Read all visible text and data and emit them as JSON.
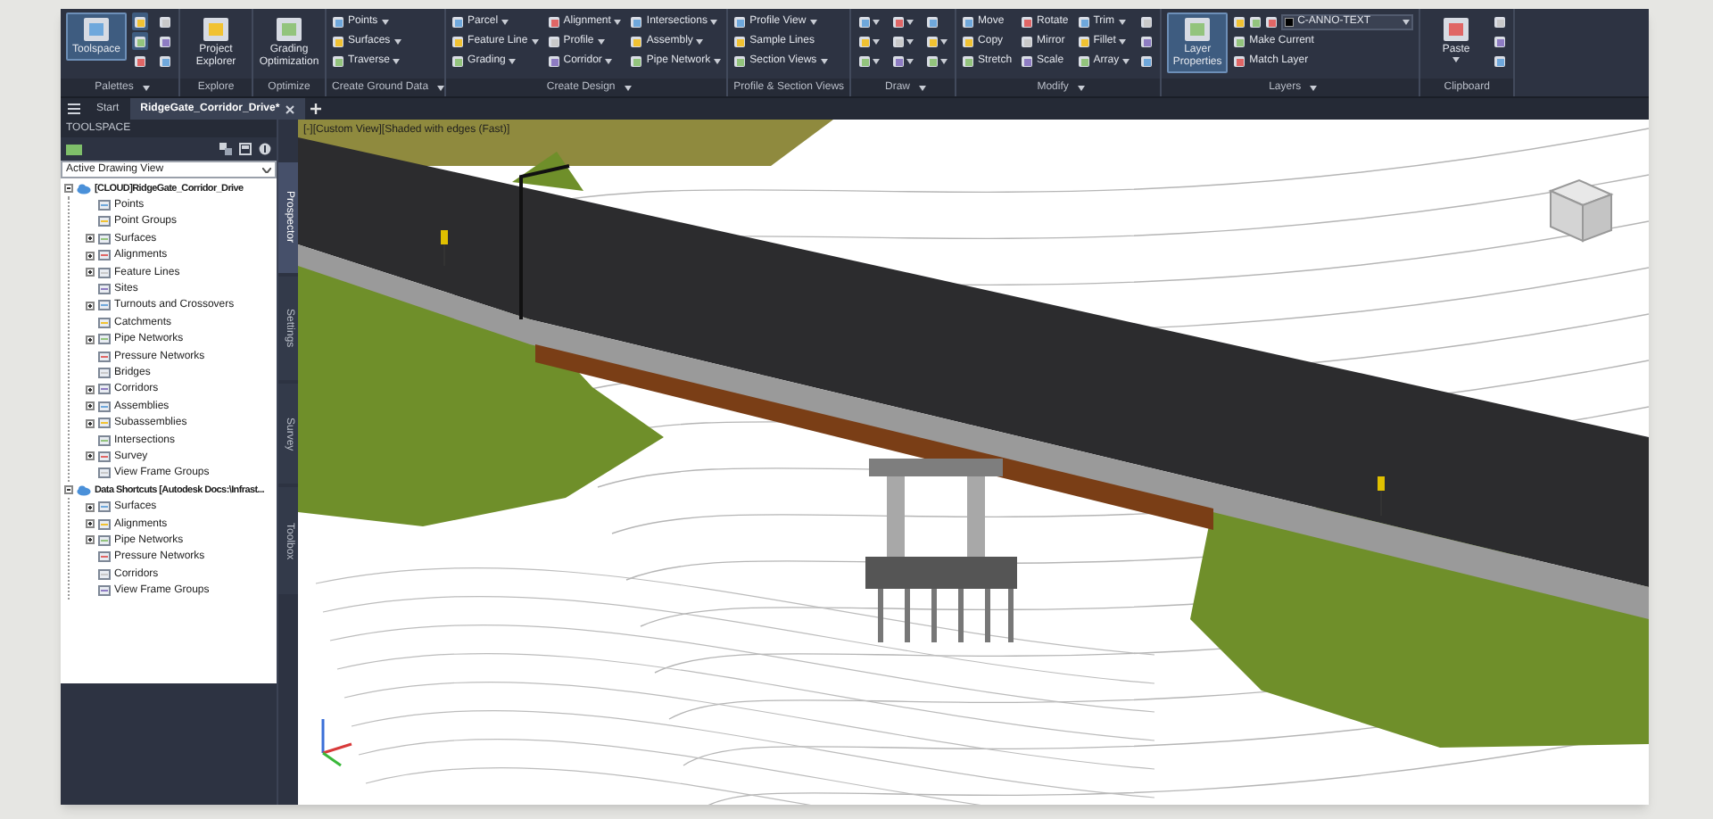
{
  "ribbon": {
    "panels": [
      {
        "title": "Palettes",
        "dropdown": true,
        "items": [
          {
            "kind": "large",
            "label": "Toolspace",
            "on": true
          },
          {
            "kind": "icon",
            "on": true
          },
          {
            "kind": "icon",
            "on": true
          },
          {
            "kind": "icon",
            "on": false
          },
          {
            "kind": "icon",
            "on": false
          },
          {
            "kind": "icon",
            "on": false
          },
          {
            "kind": "icon",
            "on": false
          }
        ]
      },
      {
        "title": "Explore",
        "dropdown": false,
        "items": [
          {
            "kind": "large",
            "label": "Project Explorer"
          }
        ]
      },
      {
        "title": "Optimize",
        "dropdown": false,
        "items": [
          {
            "kind": "large",
            "label": "Grading Optimization"
          }
        ]
      },
      {
        "title": "Create Ground Data",
        "dropdown": true,
        "items": [
          {
            "kind": "small",
            "label": "Points",
            "dropdown": true
          },
          {
            "kind": "small",
            "label": "Surfaces",
            "dropdown": true
          },
          {
            "kind": "small",
            "label": "Traverse",
            "dropdown": true
          }
        ]
      },
      {
        "title": "Create Design",
        "dropdown": true,
        "items": [
          {
            "kind": "small",
            "label": "Parcel",
            "dropdown": true
          },
          {
            "kind": "small",
            "label": "Feature Line",
            "dropdown": true
          },
          {
            "kind": "small",
            "label": "Grading",
            "dropdown": true
          },
          {
            "kind": "small",
            "label": "Alignment",
            "dropdown": true
          },
          {
            "kind": "small",
            "label": "Profile",
            "dropdown": true
          },
          {
            "kind": "small",
            "label": "Corridor",
            "dropdown": true
          },
          {
            "kind": "small",
            "label": "Intersections",
            "dropdown": true
          },
          {
            "kind": "small",
            "label": "Assembly",
            "dropdown": true
          },
          {
            "kind": "small",
            "label": "Pipe Network",
            "dropdown": true
          }
        ]
      },
      {
        "title": "Profile & Section Views",
        "dropdown": false,
        "items": [
          {
            "kind": "small",
            "label": "Profile View",
            "dropdown": true
          },
          {
            "kind": "small",
            "label": "Sample Lines",
            "dropdown": false
          },
          {
            "kind": "small",
            "label": "Section Views",
            "dropdown": true
          }
        ]
      },
      {
        "title": "Draw",
        "dropdown": true,
        "items": [
          {
            "kind": "icon",
            "dropdown": true
          },
          {
            "kind": "icon",
            "dropdown": true
          },
          {
            "kind": "icon",
            "dropdown": true
          },
          {
            "kind": "icon",
            "dropdown": true
          },
          {
            "kind": "icon",
            "dropdown": true
          },
          {
            "kind": "icon",
            "dropdown": true
          },
          {
            "kind": "icon",
            "dropdown": false
          },
          {
            "kind": "icon",
            "dropdown": true
          },
          {
            "kind": "icon",
            "dropdown": true
          }
        ]
      },
      {
        "title": "Modify",
        "dropdown": true,
        "items": [
          {
            "kind": "small",
            "label": "Move",
            "dropdown": false
          },
          {
            "kind": "small",
            "label": "Copy",
            "dropdown": false
          },
          {
            "kind": "small",
            "label": "Stretch",
            "dropdown": false
          },
          {
            "kind": "small",
            "label": "Rotate",
            "dropdown": false
          },
          {
            "kind": "small",
            "label": "Mirror",
            "dropdown": false
          },
          {
            "kind": "small",
            "label": "Scale",
            "dropdown": false
          },
          {
            "kind": "small",
            "label": "Trim",
            "dropdown": true
          },
          {
            "kind": "small",
            "label": "Fillet",
            "dropdown": true
          },
          {
            "kind": "small",
            "label": "Array",
            "dropdown": true
          },
          {
            "kind": "icon",
            "dropdown": false
          },
          {
            "kind": "icon",
            "dropdown": false
          },
          {
            "kind": "icon",
            "dropdown": false
          }
        ]
      },
      {
        "title": "Layers",
        "dropdown": true,
        "items": [
          {
            "kind": "large",
            "label": "Layer Properties",
            "on": true
          },
          {
            "kind": "combo",
            "value": "C-ANNO-TEXT"
          },
          {
            "kind": "small",
            "label": "Make Current",
            "dropdown": false
          },
          {
            "kind": "small",
            "label": "Match Layer",
            "dropdown": false
          }
        ]
      },
      {
        "title": "Clipboard",
        "dropdown": false,
        "items": [
          {
            "kind": "large",
            "label": "Paste",
            "dropdown": true
          },
          {
            "kind": "icon",
            "dropdown": false
          },
          {
            "kind": "icon",
            "dropdown": false
          },
          {
            "kind": "icon",
            "dropdown": false
          }
        ]
      }
    ]
  },
  "tabs": [
    {
      "label": "Start",
      "selected": false
    },
    {
      "label": "RidgeGate_Corridor_Drive*",
      "selected": true
    }
  ],
  "toolspace": {
    "title": "TOOLSPACE",
    "view": "Active Drawing View",
    "tree": [
      {
        "label": "[CLOUD]RidgeGate_Corridor_Drive",
        "kind": "expanded",
        "children": [
          {
            "label": "Points",
            "kind": "leaf"
          },
          {
            "label": "Point Groups",
            "kind": "leaf"
          },
          {
            "label": "Surfaces",
            "kind": "collapsed"
          },
          {
            "label": "Alignments",
            "kind": "collapsed"
          },
          {
            "label": "Feature Lines",
            "kind": "collapsed"
          },
          {
            "label": "Sites",
            "kind": "leaf"
          },
          {
            "label": "Turnouts and Crossovers",
            "kind": "collapsed"
          },
          {
            "label": "Catchments",
            "kind": "leaf"
          },
          {
            "label": "Pipe Networks",
            "kind": "collapsed"
          },
          {
            "label": "Pressure Networks",
            "kind": "leaf"
          },
          {
            "label": "Bridges",
            "kind": "leaf"
          },
          {
            "label": "Corridors",
            "kind": "collapsed"
          },
          {
            "label": "Assemblies",
            "kind": "collapsed"
          },
          {
            "label": "Subassemblies",
            "kind": "collapsed"
          },
          {
            "label": "Intersections",
            "kind": "leaf"
          },
          {
            "label": "Survey",
            "kind": "collapsed"
          },
          {
            "label": "View Frame Groups",
            "kind": "leaf"
          }
        ]
      },
      {
        "label": "Data Shortcuts [Autodesk Docs:\\Infrast...",
        "kind": "expanded",
        "children": [
          {
            "label": "Surfaces",
            "kind": "collapsed"
          },
          {
            "label": "Alignments",
            "kind": "collapsed"
          },
          {
            "label": "Pipe Networks",
            "kind": "collapsed"
          },
          {
            "label": "Pressure Networks",
            "kind": "leaf"
          },
          {
            "label": "Corridors",
            "kind": "leaf"
          },
          {
            "label": "View Frame Groups",
            "kind": "leaf"
          }
        ]
      }
    ],
    "side_tabs": [
      {
        "label": "Prospector",
        "selected": true
      },
      {
        "label": "Settings",
        "selected": false
      },
      {
        "label": "Survey",
        "selected": false
      },
      {
        "label": "Toolbox",
        "selected": false
      }
    ]
  },
  "viewport": {
    "label": "[-][Custom View][Shaded with edges (Fast)]"
  }
}
